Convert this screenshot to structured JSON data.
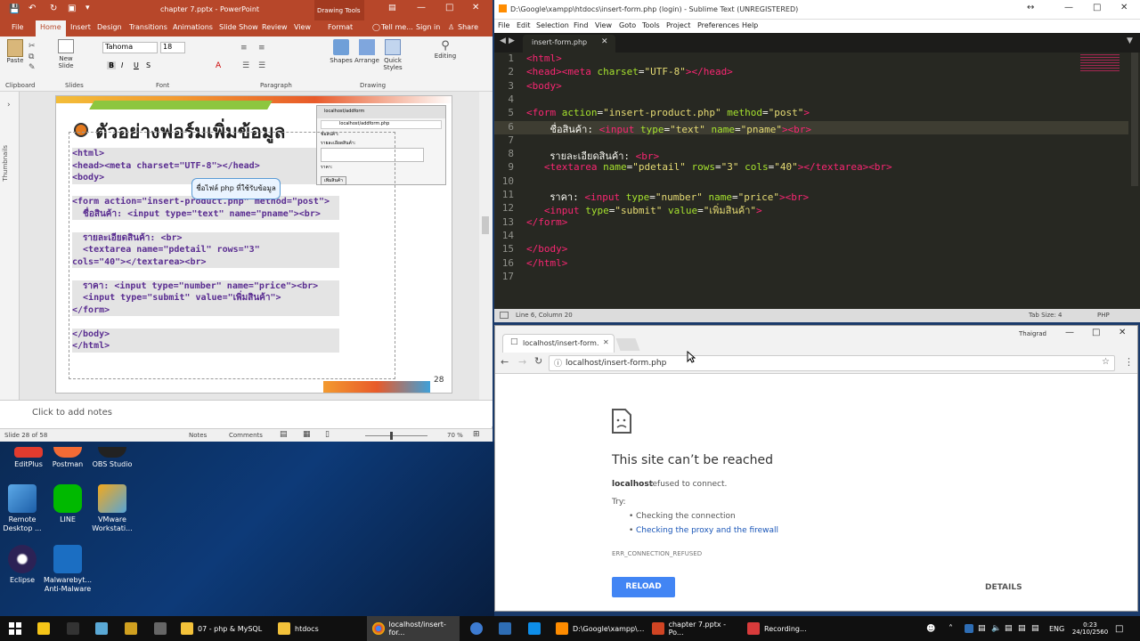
{
  "ppt": {
    "title": "chapter 7.pptx - PowerPoint",
    "drawing_tools": "Drawing Tools",
    "tell_me": "Tell me...",
    "sign_in": "Sign in",
    "share": "Share",
    "tabs": [
      "File",
      "Home",
      "Insert",
      "Design",
      "Transitions",
      "Animations",
      "Slide Show",
      "Review",
      "View",
      "Format"
    ],
    "font_name": "Tahoma",
    "font_size": "18",
    "groups": [
      "Clipboard",
      "Slides",
      "Font",
      "Paragraph",
      "Drawing"
    ],
    "buttons": {
      "paste": "Paste",
      "new_slide": "New Slide",
      "shapes": "Shapes",
      "arrange": "Arrange",
      "quick_styles": "Quick Styles",
      "editing": "Editing"
    },
    "thumbnails_label": "Thumbnails",
    "slide": {
      "title": "ตัวอย่างฟอร์มเพิ่มข้อมูล",
      "callout": "ชื่อไฟล์ php ที่ใช้รับข้อมูล",
      "page_number": "28",
      "mini_tab": "localhost/addform",
      "mini_url": "localhost/addform.php",
      "mini_label_name": "ชื่อสินค้า:",
      "mini_label_detail": "รายละเอียดสินค้า:",
      "mini_label_price": "ราคา:",
      "mini_button": "เพิ่มสินค้า",
      "lines": [
        "<html>",
        "<head><meta charset=\"UTF-8\"></head>",
        "<body>",
        "",
        "<form action=\"insert-product.php\" method=\"post\">",
        "  ชื่อสินค้า: <input type=\"text\" name=\"pname\"><br>",
        "",
        "  รายละเอียดสินค้า: <br>",
        "  <textarea name=\"pdetail\" rows=\"3\"",
        "cols=\"40\"></textarea><br>",
        "",
        "  ราคา: <input type=\"number\" name=\"price\"><br>",
        "  <input type=\"submit\" value=\"เพิ่มสินค้า\">",
        "</form>",
        "",
        "</body>",
        "</html>"
      ]
    },
    "notes_placeholder": "Click to add notes",
    "status": {
      "slide": "Slide 28 of 58",
      "notes": "Notes",
      "comments": "Comments",
      "zoom": "70 %"
    }
  },
  "desktop": {
    "icons": [
      "EditPlus",
      "Postman",
      "OBS Studio",
      "Remote Desktop ...",
      "LINE",
      "VMware Workstati...",
      "Eclipse",
      "Malwarebyt... Anti-Malware"
    ]
  },
  "sublime": {
    "title": "D:\\Google\\xampp\\htdocs\\insert-form.php (login) - Sublime Text (UNREGISTERED)",
    "menu": [
      "File",
      "Edit",
      "Selection",
      "Find",
      "View",
      "Goto",
      "Tools",
      "Project",
      "Preferences",
      "Help"
    ],
    "tab": "insert-form.php",
    "status_left": "Line 6, Column 20",
    "status_tab": "Tab Size: 4",
    "status_syntax": "PHP",
    "line_numbers": [
      "1",
      "2",
      "3",
      "4",
      "5",
      "6",
      "7",
      "8",
      "9",
      "10",
      "11",
      "12",
      "13",
      "14",
      "15",
      "16",
      "17"
    ]
  },
  "chrome": {
    "tab_title": "localhost/insert-form.php",
    "profile": "Thaigrad",
    "url": "localhost/insert-form.php",
    "error_title": "This site can’t be reached",
    "error_host": "localhost",
    "error_desc": "refused to connect.",
    "try_label": "Try:",
    "suggestion_1": "Checking the connection",
    "suggestion_2": "Checking the proxy and the firewall",
    "error_code": "ERR_CONNECTION_REFUSED",
    "reload": "RELOAD",
    "details": "DETAILS"
  },
  "taskbar": {
    "items": [
      "07 - php & MySQL",
      "htdocs",
      "localhost/insert-for...",
      "D:\\Google\\xampp\\...",
      "chapter 7.pptx - Po...",
      "Recording..."
    ],
    "lang": "ENG",
    "time": "0:23",
    "date": "24/10/2560"
  },
  "colors": {
    "ppt_accent": "#b7472a",
    "sublime_bg": "#272822",
    "chrome_button": "#4285f4",
    "taskbar": "#101010"
  }
}
